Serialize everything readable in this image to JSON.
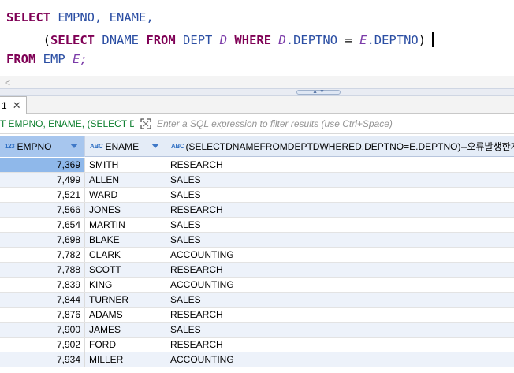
{
  "editor": {
    "line1": {
      "kw1": "SELECT",
      "t1": " EMPNO, ENAME,",
      "indent": "    "
    },
    "line2": {
      "open": "(",
      "kw1": "SELECT",
      "id1": "DNAME",
      "kw2": "FROM",
      "id2": "DEPT",
      "alias": "D",
      "kw3": "WHERE",
      "alias2": "D",
      "col": ".DEPTNO",
      "eq": " = ",
      "alias3": "E",
      "col2": ".DEPTNO",
      "close": ")"
    },
    "line3": {
      "kw1": "FROM",
      "id1": "EMP",
      "alias": "E;"
    }
  },
  "hscroll_arrow": "<",
  "result_tab": {
    "label": "1",
    "close": "✕"
  },
  "filter": {
    "query": "T EMPNO, ENAME, (SELECT DNAME",
    "placeholder": "Enter a SQL expression to filter results (use Ctrl+Space)"
  },
  "columns": [
    {
      "type": "123",
      "name": "EMPNO"
    },
    {
      "type": "ABC",
      "name": "ENAME"
    },
    {
      "type": "ABC",
      "name": "(SELECTDNAMEFROMDEPTDWHERED.DEPTNO=E.DEPTNO)--오류발생한개만나와야"
    }
  ],
  "rows": [
    {
      "empno": "7,369",
      "ename": "SMITH",
      "dname": "RESEARCH"
    },
    {
      "empno": "7,499",
      "ename": "ALLEN",
      "dname": "SALES"
    },
    {
      "empno": "7,521",
      "ename": "WARD",
      "dname": "SALES"
    },
    {
      "empno": "7,566",
      "ename": "JONES",
      "dname": "RESEARCH"
    },
    {
      "empno": "7,654",
      "ename": "MARTIN",
      "dname": "SALES"
    },
    {
      "empno": "7,698",
      "ename": "BLAKE",
      "dname": "SALES"
    },
    {
      "empno": "7,782",
      "ename": "CLARK",
      "dname": "ACCOUNTING"
    },
    {
      "empno": "7,788",
      "ename": "SCOTT",
      "dname": "RESEARCH"
    },
    {
      "empno": "7,839",
      "ename": "KING",
      "dname": "ACCOUNTING"
    },
    {
      "empno": "7,844",
      "ename": "TURNER",
      "dname": "SALES"
    },
    {
      "empno": "7,876",
      "ename": "ADAMS",
      "dname": "RESEARCH"
    },
    {
      "empno": "7,900",
      "ename": "JAMES",
      "dname": "SALES"
    },
    {
      "empno": "7,902",
      "ename": "FORD",
      "dname": "RESEARCH"
    },
    {
      "empno": "7,934",
      "ename": "MILLER",
      "dname": "ACCOUNTING"
    }
  ],
  "colors": {
    "keyword": "#7f0055",
    "identifier": "#2b4ea3",
    "alias": "#7a3aa8",
    "filter_query": "#0a7d2c",
    "header_bg": "#e4ecf7",
    "selected_cell": "#8fb8ea"
  }
}
